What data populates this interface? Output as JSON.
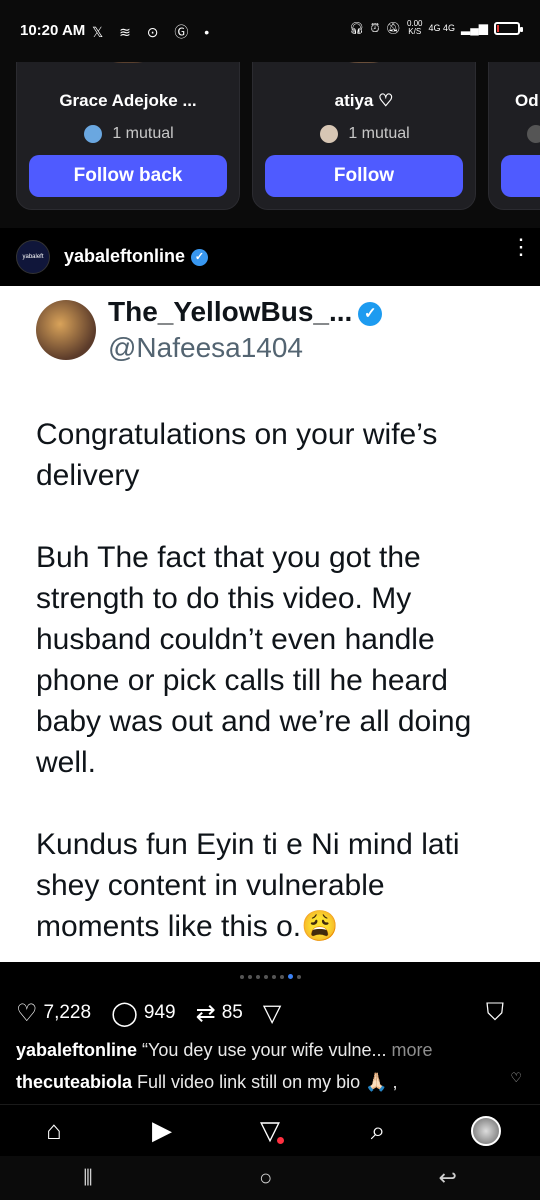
{
  "status_bar": {
    "time": "10:20 AM",
    "left_icons": "𝕏 ≋ ⊙ Ⓖ •",
    "speed": "0.00\nK/S",
    "network": "4G 4G",
    "battery_color": "#e53935",
    "battery_level": 0.08
  },
  "suggestions": [
    {
      "name": "Grace Adejoke ...",
      "mutual": "1 mutual",
      "button": "Follow back"
    },
    {
      "name": "atiya ♡",
      "mutual": "1 mutual",
      "button": "Follow"
    },
    {
      "name": "Od",
      "mutual": "",
      "button": ""
    }
  ],
  "post": {
    "username": "yabaleftonline",
    "avatar_text": "yabaleft",
    "more_icon": "⋮"
  },
  "tweet": {
    "display_name": "The_YellowBus_...",
    "handle": "@Nafeesa1404",
    "paragraphs": [
      "Congratulations on your wife’s delivery",
      "Buh The fact that you got the strength to do this video. My husband couldn’t even handle phone or pick calls till he heard baby was out and we’re all doing well.",
      "Kundus fun Eyin ti e Ni mind lati shey content in vulnerable moments like this o.😩"
    ]
  },
  "actions": {
    "likes": "7,228",
    "comments": "949",
    "reposts": "85",
    "carousel_total": 8,
    "carousel_active": 7
  },
  "caption": {
    "username": "yabaleftonline",
    "text": "“You dey use your wife vulne...",
    "more": "more"
  },
  "comment": {
    "username": "thecuteabiola",
    "text": "Full video link still on my bio 🙏🏻 ,"
  },
  "accent_color": "#4f5bff"
}
